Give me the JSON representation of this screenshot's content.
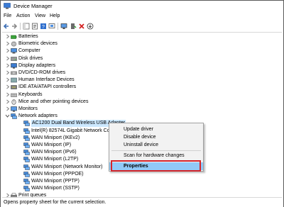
{
  "window": {
    "title": "Device Manager"
  },
  "menu": [
    "File",
    "Action",
    "View",
    "Help"
  ],
  "tree": [
    {
      "label": "Batteries",
      "icon": "battery-icon",
      "expanded": false,
      "depth": 0
    },
    {
      "label": "Biometric devices",
      "icon": "fingerprint-icon",
      "expanded": false,
      "depth": 0
    },
    {
      "label": "Computer",
      "icon": "computer-icon",
      "expanded": false,
      "depth": 0
    },
    {
      "label": "Disk drives",
      "icon": "disk-icon",
      "expanded": false,
      "depth": 0
    },
    {
      "label": "Display adapters",
      "icon": "display-icon",
      "expanded": false,
      "depth": 0
    },
    {
      "label": "DVD/CD-ROM drives",
      "icon": "dvd-icon",
      "expanded": false,
      "depth": 0
    },
    {
      "label": "Human Interface Devices",
      "icon": "hid-icon",
      "expanded": false,
      "depth": 0
    },
    {
      "label": "IDE ATA/ATAPI controllers",
      "icon": "ide-icon",
      "expanded": false,
      "depth": 0
    },
    {
      "label": "Keyboards",
      "icon": "keyboard-icon",
      "expanded": false,
      "depth": 0
    },
    {
      "label": "Mice and other pointing devices",
      "icon": "mouse-icon",
      "expanded": false,
      "depth": 0
    },
    {
      "label": "Monitors",
      "icon": "monitor-icon",
      "expanded": false,
      "depth": 0
    },
    {
      "label": "Network adapters",
      "icon": "network-icon",
      "expanded": true,
      "depth": 0
    },
    {
      "label": "AC1200  Dual Band Wireless USB Adapter",
      "icon": "network-icon",
      "depth": 1,
      "selected": true
    },
    {
      "label": "Intel(R) 82574L Gigabit Network Conn",
      "icon": "network-icon",
      "depth": 1
    },
    {
      "label": "WAN Miniport (IKEv2)",
      "icon": "network-icon",
      "depth": 1
    },
    {
      "label": "WAN Miniport (IP)",
      "icon": "network-icon",
      "depth": 1
    },
    {
      "label": "WAN Miniport (IPv6)",
      "icon": "network-icon",
      "depth": 1
    },
    {
      "label": "WAN Miniport (L2TP)",
      "icon": "network-icon",
      "depth": 1
    },
    {
      "label": "WAN Miniport (Network Monitor)",
      "icon": "network-icon",
      "depth": 1
    },
    {
      "label": "WAN Miniport (PPPOE)",
      "icon": "network-icon",
      "depth": 1
    },
    {
      "label": "WAN Miniport (PPTP)",
      "icon": "network-icon",
      "depth": 1
    },
    {
      "label": "WAN Miniport (SSTP)",
      "icon": "network-icon",
      "depth": 1
    },
    {
      "label": "Print queues",
      "icon": "printer-icon",
      "expanded": false,
      "depth": 0
    }
  ],
  "context_menu": {
    "items": [
      "Update driver",
      "Disable device",
      "Uninstall device",
      "Scan for hardware changes",
      "Properties"
    ],
    "highlighted": "Properties"
  },
  "status": "Opens property sheet for the current selection.",
  "colors": {
    "selection": "#cce8ff",
    "highlight": "#91c9f7",
    "outline": "#d4242a"
  }
}
